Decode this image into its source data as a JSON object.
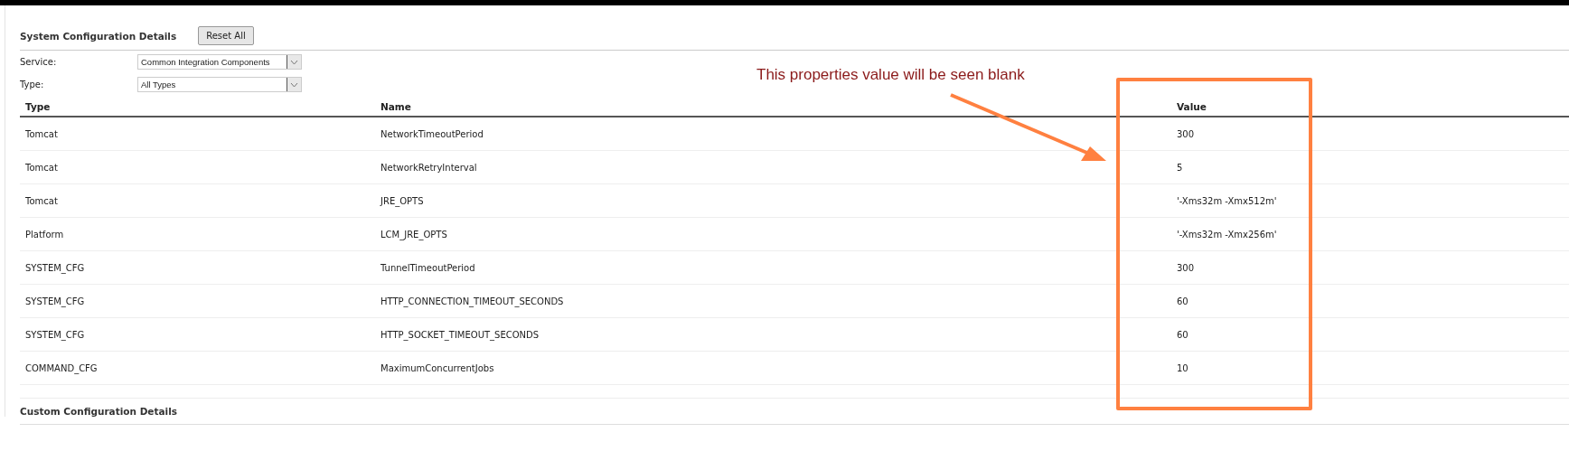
{
  "section_title": "System Configuration Details",
  "reset_button": "Reset All",
  "filters": [
    {
      "label": "Service:",
      "value": "Common Integration Components"
    },
    {
      "label": "Type:",
      "value": "All Types"
    }
  ],
  "table": {
    "columns": [
      "Type",
      "Name",
      "Value"
    ],
    "rows": [
      [
        "Tomcat",
        "NetworkTimeoutPeriod",
        "300"
      ],
      [
        "Tomcat",
        "NetworkRetryInterval",
        "5"
      ],
      [
        "Tomcat",
        "JRE_OPTS",
        "'-Xms32m -Xmx512m'"
      ],
      [
        "Platform",
        "LCM_JRE_OPTS",
        "'-Xms32m -Xmx256m'"
      ],
      [
        "SYSTEM_CFG",
        "TunnelTimeoutPeriod",
        "300"
      ],
      [
        "SYSTEM_CFG",
        "HTTP_CONNECTION_TIMEOUT_SECONDS",
        "60"
      ],
      [
        "SYSTEM_CFG",
        "HTTP_SOCKET_TIMEOUT_SECONDS",
        "60"
      ],
      [
        "COMMAND_CFG",
        "MaximumConcurrentJobs",
        "10"
      ]
    ]
  },
  "custom_section_title": "Custom Configuration Details",
  "annotation": {
    "text": "This properties value will be seen blank"
  }
}
